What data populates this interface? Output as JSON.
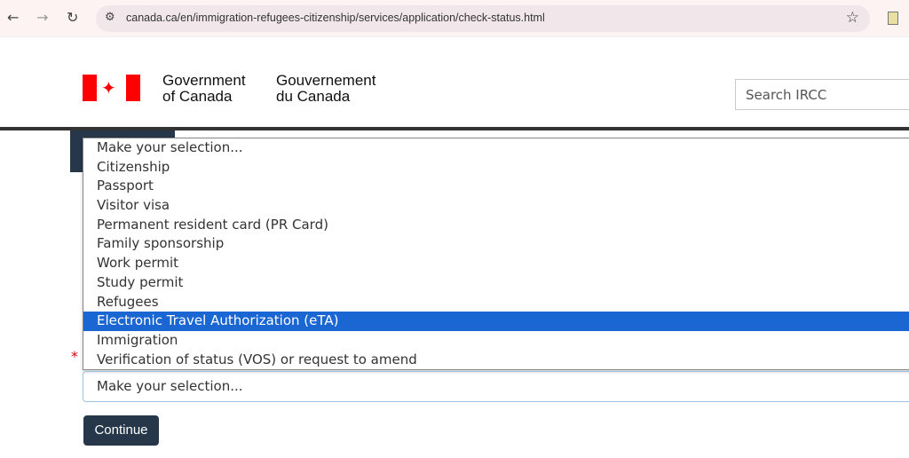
{
  "browser": {
    "back": "←",
    "forward": "→",
    "reload": "↻",
    "url": "canada.ca/en/immigration-refugees-citizenship/services/application/check-status.html"
  },
  "header": {
    "gov_en_1": "Government",
    "gov_en_2": "of Canada",
    "gov_fr_1": "Gouvernement",
    "gov_fr_2": "du Canada",
    "search_placeholder": "Search IRCC"
  },
  "dropdown": {
    "options": [
      "Make your selection...",
      "Citizenship",
      "Passport",
      "Visitor visa",
      "Permanent resident card (PR Card)",
      "Family sponsorship",
      "Work permit",
      "Study permit",
      "Refugees",
      "Electronic Travel Authorization (eTA)",
      "Immigration",
      "Verification of status (VOS) or request to amend"
    ],
    "highlighted": "Electronic Travel Authorization (eTA)",
    "highlight_color": "#1a66d2"
  },
  "form": {
    "required_marker": "*",
    "select_value": "Make your selection...",
    "continue_label": "Continue"
  }
}
